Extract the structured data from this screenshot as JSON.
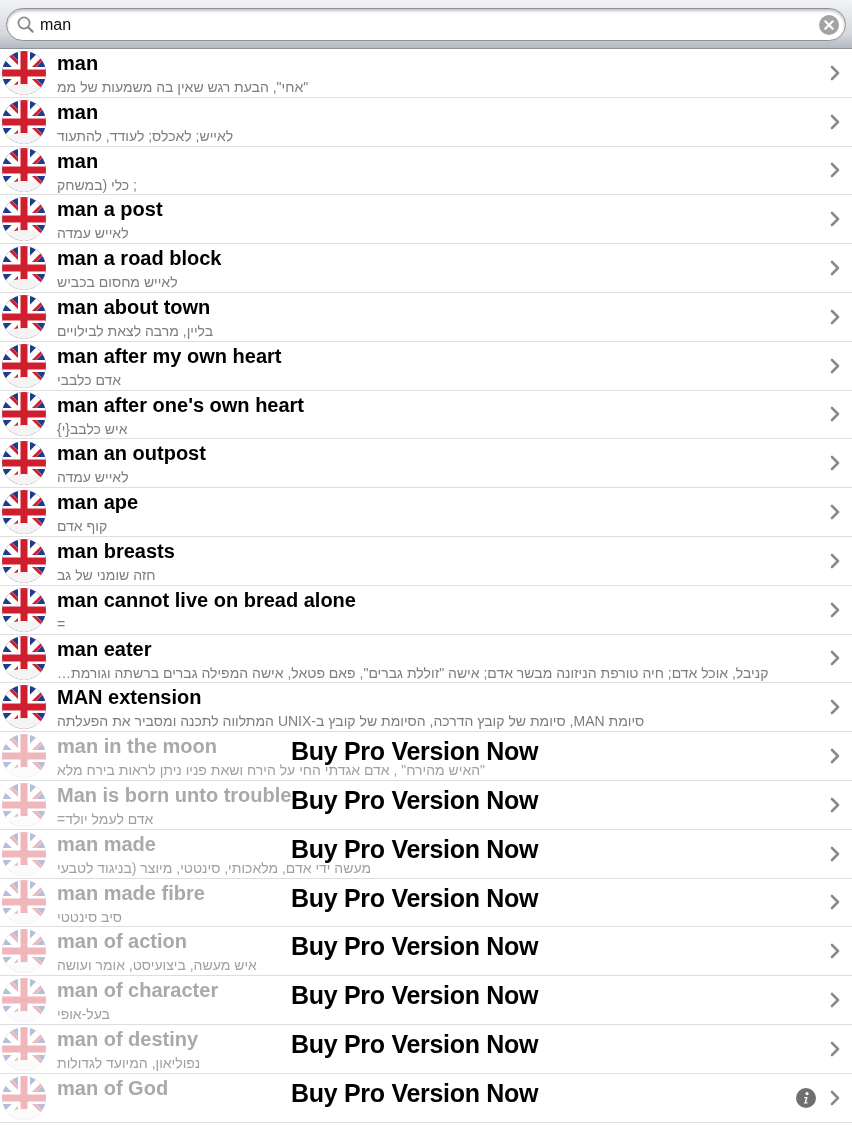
{
  "search": {
    "value": "man"
  },
  "rows": [
    {
      "title": "man",
      "subtitle": "\"אחי\", הבעת רגש שאין בה משמעות של ממ",
      "locked": false,
      "info": false
    },
    {
      "title": "man",
      "subtitle": "לאייש; לאכלס; לעודד, להתעוד",
      "locked": false,
      "info": false
    },
    {
      "title": "man",
      "subtitle": "; כלי (במשחק",
      "locked": false,
      "info": false
    },
    {
      "title": "man a post",
      "subtitle": "לאייש עמדה",
      "locked": false,
      "info": false
    },
    {
      "title": "man a road block",
      "subtitle": "לאייש מחסום בכביש",
      "locked": false,
      "info": false
    },
    {
      "title": "man about town",
      "subtitle": "בליין, מרבה לצאת לבילויים",
      "locked": false,
      "info": false
    },
    {
      "title": "man after my own heart",
      "subtitle": "אדם כלבבי",
      "locked": false,
      "info": false
    },
    {
      "title": "man after one's own heart",
      "subtitle": "איש כלבב{י}",
      "locked": false,
      "info": false
    },
    {
      "title": "man an outpost",
      "subtitle": "לאייש עמדה",
      "locked": false,
      "info": false
    },
    {
      "title": "man ape",
      "subtitle": "קוף אדם",
      "locked": false,
      "info": false
    },
    {
      "title": "man breasts",
      "subtitle": "חזה שומני של גב",
      "locked": false,
      "info": false
    },
    {
      "title": "man cannot live on bread alone",
      "subtitle": "=",
      "locked": false,
      "info": false
    },
    {
      "title": "man eater",
      "subtitle": "קניבל, אוכל אדם; חיה טורפת הניזונה מבשר אדם; אישה \"זוללת גברים\", פאם פטאל, אישה המפילה גברים ברשתה וגורמת…",
      "locked": false,
      "info": false
    },
    {
      "title": "MAN extension",
      "subtitle": "סיומת MAN, סיומת של קובץ הדרכה, הסיומת של קובץ ב-UNIX המתלווה לתכנה ומסביר את הפעלתה",
      "locked": false,
      "info": false
    },
    {
      "title": "man in the moon",
      "subtitle": "\"האיש מהירח\" , אדם אגדתי החי על הירח ושאת פניו ניתן לראות בירח מלא",
      "locked": true,
      "info": false,
      "overlay": "Buy Pro Version Now"
    },
    {
      "title": "Man is born unto trouble",
      "subtitle": "אדם לעמל יולד=",
      "locked": true,
      "info": false,
      "overlay": "Buy Pro Version Now"
    },
    {
      "title": "man made",
      "subtitle": "מעשה ידי אדם, מלאכותי, סינטטי, מיוצר (בניגוד לטבעי",
      "locked": true,
      "info": false,
      "overlay": "Buy Pro Version Now"
    },
    {
      "title": "man made fibre",
      "subtitle": "סיב סינטטי",
      "locked": true,
      "info": false,
      "overlay": "Buy Pro Version Now"
    },
    {
      "title": "man of action",
      "subtitle": "איש מעשה, ביצועיסט, אומר ועושה",
      "locked": true,
      "info": false,
      "overlay": "Buy Pro Version Now"
    },
    {
      "title": "man of character",
      "subtitle": "בעל-אופי",
      "locked": true,
      "info": false,
      "overlay": "Buy Pro Version Now"
    },
    {
      "title": "man of destiny",
      "subtitle": "נפוליאון, המיועד לגדולות",
      "locked": true,
      "info": false,
      "overlay": "Buy Pro Version Now"
    },
    {
      "title": "man of God",
      "locked": true,
      "info": true,
      "overlay": "Buy Pro Version Now"
    }
  ]
}
